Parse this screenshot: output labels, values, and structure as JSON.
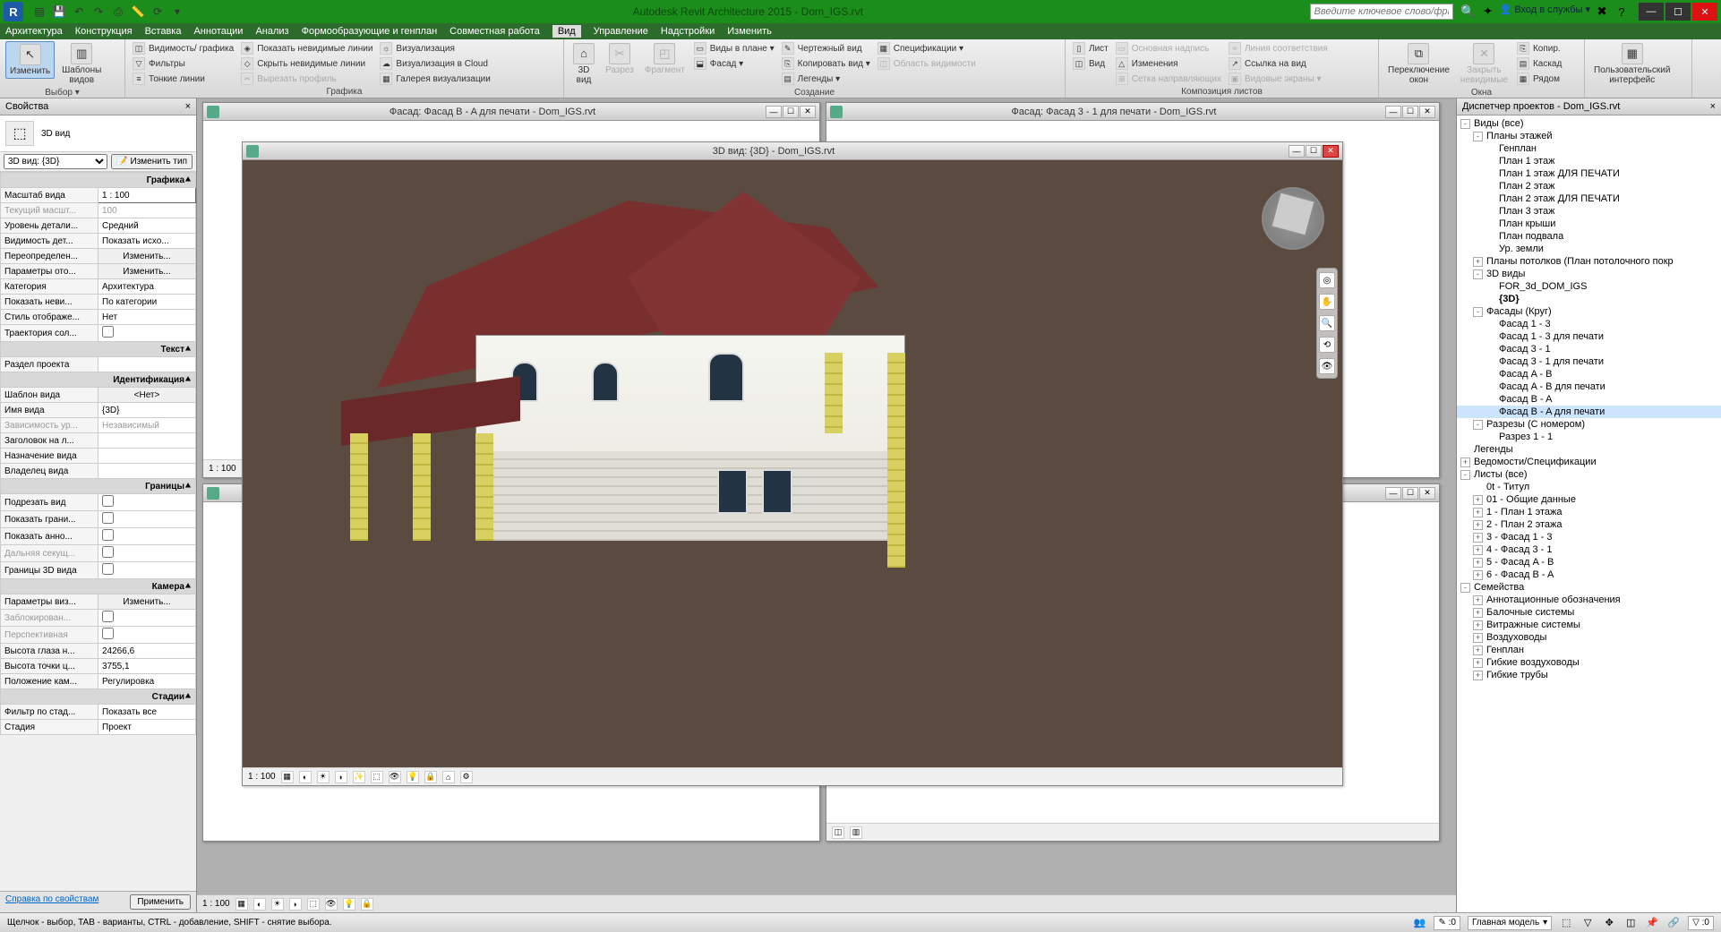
{
  "app": {
    "title": "Autodesk Revit Architecture 2015 -     Dom_IGS.rvt",
    "search_placeholder": "Введите ключевое слово/фразу",
    "login": "Вход в службы"
  },
  "menu": [
    "Архитектура",
    "Конструкция",
    "Вставка",
    "Аннотации",
    "Анализ",
    "Формообразующие и генплан",
    "Совместная работа",
    "Вид",
    "Управление",
    "Надстройки",
    "Изменить"
  ],
  "menu_active": "Вид",
  "ribbon": {
    "g_select": {
      "modify": "Изменить",
      "templates": "Шаблоны\nвидов",
      "label": "Выбор ▾"
    },
    "g_graphics": {
      "visibility": "Видимость/ графика",
      "filters": "Фильтры",
      "thin": "Тонкие линии",
      "show_hidden": "Показать невидимые линии",
      "hide_hidden": "Скрыть невидимые линии",
      "cut_profile": "Вырезать профиль",
      "viz": "Визуализация",
      "viz_cloud": "Визуализация в Cloud",
      "gallery": "Галерея визуализации",
      "label": "Графика"
    },
    "g_create": {
      "view3d": "3D\nвид",
      "section": "Разрез",
      "fragment": "Фрагмент",
      "plan_views": "Виды в плане ▾",
      "facade": "Фасад ▾",
      "drafting": "Чертежный вид",
      "copy_view": "Копировать вид ▾",
      "legends": "Легенды ▾",
      "schedules": "Спецификации ▾",
      "scope": "Область видимости",
      "label": "Создание"
    },
    "g_sheets": {
      "sheet": "Лист",
      "view": "Вид",
      "title": "Основная надпись",
      "revisions": "Изменения",
      "grid": "Сетка направляющих",
      "match": "Линия соответствия",
      "ref": "Ссылка на вид",
      "viewports": "Видовые экраны ▾",
      "label": "Композиция листов"
    },
    "g_windows": {
      "switch": "Переключение\nокон",
      "close": "Закрыть\nневидимые",
      "dup": "Копир.",
      "casc": "Каскад",
      "tile": "Рядом",
      "label": "Окна"
    },
    "g_ui": {
      "ui": "Пользовательский\nинтерфейс",
      "label": ""
    }
  },
  "props": {
    "title": "Свойства",
    "type": "3D вид",
    "selector_label": "3D вид: {3D}",
    "edit_type": "Изменить тип",
    "groups": {
      "graphics": {
        "hdr": "Графика",
        "scale": {
          "k": "Масштаб вида",
          "v": "1 : 100"
        },
        "curscale": {
          "k": "Текущий масшт...",
          "v": "100"
        },
        "detail": {
          "k": "Уровень детали...",
          "v": "Средний"
        },
        "visdet": {
          "k": "Видимость дет...",
          "v": "Показать исхо..."
        },
        "override": {
          "k": "Переопределен...",
          "v": "Изменить..."
        },
        "dispopt": {
          "k": "Параметры ото...",
          "v": "Изменить..."
        },
        "discipline": {
          "k": "Категория",
          "v": "Архитектура"
        },
        "showhidden": {
          "k": "Показать неви...",
          "v": "По категории"
        },
        "style": {
          "k": "Стиль отображе...",
          "v": "Нет"
        },
        "sunpath": {
          "k": "Траектория сол...",
          "v": ""
        }
      },
      "text": {
        "hdr": "Текст",
        "section": {
          "k": "Раздел проекта",
          "v": ""
        }
      },
      "ident": {
        "hdr": "Идентификация",
        "template": {
          "k": "Шаблон вида",
          "v": "<Нет>"
        },
        "name": {
          "k": "Имя вида",
          "v": "{3D}"
        },
        "dep": {
          "k": "Зависимость ур...",
          "v": "Независимый"
        },
        "titlesheet": {
          "k": "Заголовок на л...",
          "v": ""
        },
        "purpose": {
          "k": "Назначение вида",
          "v": ""
        },
        "owner": {
          "k": "Владелец вида",
          "v": ""
        }
      },
      "bounds": {
        "hdr": "Границы",
        "crop": {
          "k": "Подрезать вид"
        },
        "showcrop": {
          "k": "Показать грани..."
        },
        "annocrop": {
          "k": "Показать анно..."
        },
        "far": {
          "k": "Дальняя секущ..."
        },
        "bounds3d": {
          "k": "Границы 3D вида"
        }
      },
      "camera": {
        "hdr": "Камера",
        "render": {
          "k": "Параметры виз...",
          "v": "Изменить..."
        },
        "locked": {
          "k": "Заблокирован..."
        },
        "persp": {
          "k": "Перспективная"
        },
        "eye": {
          "k": "Высота глаза н...",
          "v": "24266,6"
        },
        "target": {
          "k": "Высота точки ц...",
          "v": "3755,1"
        },
        "campos": {
          "k": "Положение кам...",
          "v": "Регулировка"
        }
      },
      "phases": {
        "hdr": "Стадии",
        "filter": {
          "k": "Фильтр по стад...",
          "v": "Показать все"
        },
        "phase": {
          "k": "Стадия",
          "v": "Проект"
        }
      }
    },
    "help": "Справка по свойствам",
    "apply": "Применить"
  },
  "docs": {
    "facade_b": "Фасад: Фасад B - A для печати - Dom_IGS.rvt",
    "facade_3": "Фасад: Фасад 3 - 1 для печати - Dom_IGS.rvt",
    "view3d": "3D вид: {3D} - Dom_IGS.rvt",
    "scale": "1 : 100"
  },
  "browser": {
    "title": "Диспетчер проектов - Dom_IGS.rvt",
    "items": [
      {
        "ind": 0,
        "tw": "-",
        "label": "Виды (все)"
      },
      {
        "ind": 1,
        "tw": "-",
        "label": "Планы этажей"
      },
      {
        "ind": 2,
        "tw": "",
        "label": "Генплан"
      },
      {
        "ind": 2,
        "tw": "",
        "label": "План 1 этаж"
      },
      {
        "ind": 2,
        "tw": "",
        "label": "План 1 этаж ДЛЯ ПЕЧАТИ"
      },
      {
        "ind": 2,
        "tw": "",
        "label": "План 2 этаж"
      },
      {
        "ind": 2,
        "tw": "",
        "label": "План 2 этаж ДЛЯ ПЕЧАТИ"
      },
      {
        "ind": 2,
        "tw": "",
        "label": "План 3 этаж"
      },
      {
        "ind": 2,
        "tw": "",
        "label": "План крыши"
      },
      {
        "ind": 2,
        "tw": "",
        "label": "План подвала"
      },
      {
        "ind": 2,
        "tw": "",
        "label": "Ур. земли"
      },
      {
        "ind": 1,
        "tw": "+",
        "label": "Планы потолков (План потолочного покр"
      },
      {
        "ind": 1,
        "tw": "-",
        "label": "3D виды"
      },
      {
        "ind": 2,
        "tw": "",
        "label": "FOR_3d_DOM_IGS"
      },
      {
        "ind": 2,
        "tw": "",
        "label": "{3D}",
        "bold": true
      },
      {
        "ind": 1,
        "tw": "-",
        "label": "Фасады (Круг)"
      },
      {
        "ind": 2,
        "tw": "",
        "label": "Фасад 1 - 3"
      },
      {
        "ind": 2,
        "tw": "",
        "label": "Фасад 1 - 3 для печати"
      },
      {
        "ind": 2,
        "tw": "",
        "label": "Фасад 3 - 1"
      },
      {
        "ind": 2,
        "tw": "",
        "label": "Фасад 3 - 1 для печати"
      },
      {
        "ind": 2,
        "tw": "",
        "label": "Фасад A - B"
      },
      {
        "ind": 2,
        "tw": "",
        "label": "Фасад A - B для печати"
      },
      {
        "ind": 2,
        "tw": "",
        "label": "Фасад B - A"
      },
      {
        "ind": 2,
        "tw": "",
        "label": "Фасад B - A для печати",
        "sel": true
      },
      {
        "ind": 1,
        "tw": "-",
        "label": "Разрезы (С номером)"
      },
      {
        "ind": 2,
        "tw": "",
        "label": "Разрез 1 - 1"
      },
      {
        "ind": 0,
        "tw": "",
        "label": "Легенды"
      },
      {
        "ind": 0,
        "tw": "+",
        "label": "Ведомости/Спецификации"
      },
      {
        "ind": 0,
        "tw": "-",
        "label": "Листы (все)"
      },
      {
        "ind": 1,
        "tw": "",
        "label": "0t - Титул"
      },
      {
        "ind": 1,
        "tw": "+",
        "label": "01 - Общие данные"
      },
      {
        "ind": 1,
        "tw": "+",
        "label": "1 - План 1 этажа"
      },
      {
        "ind": 1,
        "tw": "+",
        "label": "2 - План 2 этажа"
      },
      {
        "ind": 1,
        "tw": "+",
        "label": "3 - Фасад 1 - 3"
      },
      {
        "ind": 1,
        "tw": "+",
        "label": "4 - Фасад 3 - 1"
      },
      {
        "ind": 1,
        "tw": "+",
        "label": "5 - Фасад A - B"
      },
      {
        "ind": 1,
        "tw": "+",
        "label": "6 - Фасад B - A"
      },
      {
        "ind": 0,
        "tw": "-",
        "label": "Семейства"
      },
      {
        "ind": 1,
        "tw": "+",
        "label": "Аннотационные обозначения"
      },
      {
        "ind": 1,
        "tw": "+",
        "label": "Балочные системы"
      },
      {
        "ind": 1,
        "tw": "+",
        "label": "Витражные системы"
      },
      {
        "ind": 1,
        "tw": "+",
        "label": "Воздуховоды"
      },
      {
        "ind": 1,
        "tw": "+",
        "label": "Генплан"
      },
      {
        "ind": 1,
        "tw": "+",
        "label": "Гибкие воздуховоды"
      },
      {
        "ind": 1,
        "tw": "+",
        "label": "Гибкие трубы"
      }
    ]
  },
  "status": {
    "hint": "Щелчок - выбор, TAB - варианты, CTRL - добавление, SHIFT - снятие выбора.",
    "model": "Главная модель"
  }
}
